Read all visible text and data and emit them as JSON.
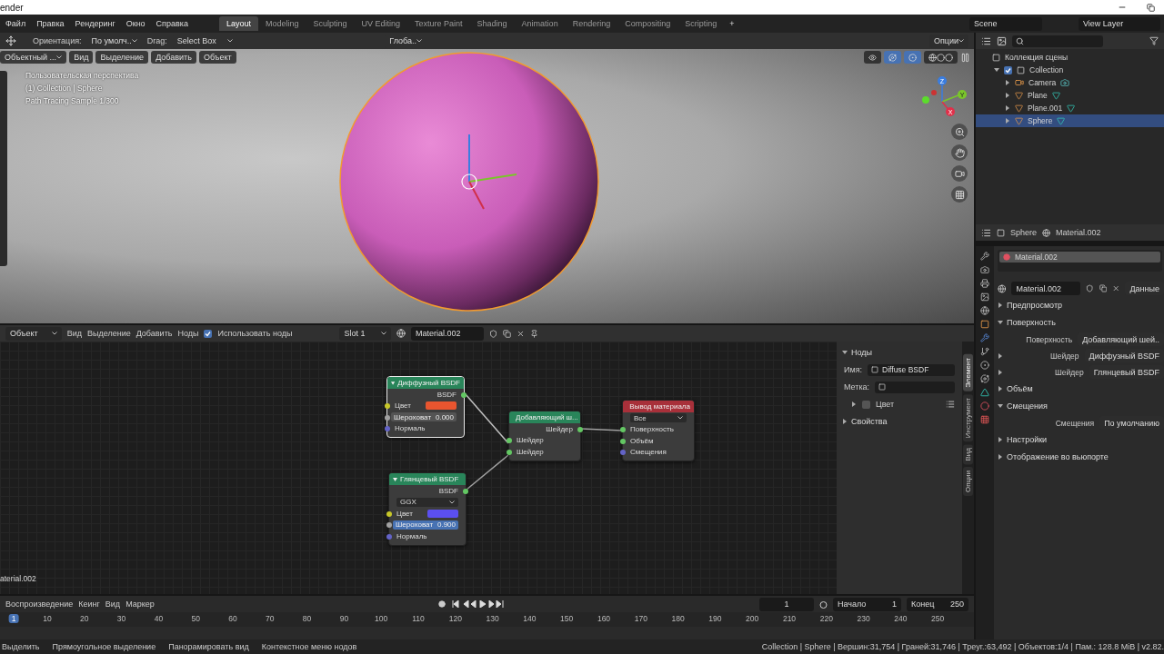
{
  "window": {
    "title": "ender"
  },
  "menu": [
    "Файл",
    "Правка",
    "Рендеринг",
    "Окно",
    "Справка"
  ],
  "workspaces": [
    {
      "label": "Layout",
      "selected": true
    },
    {
      "label": "Modeling",
      "selected": false
    },
    {
      "label": "Sculpting",
      "selected": false
    },
    {
      "label": "UV Editing",
      "selected": false
    },
    {
      "label": "Texture Paint",
      "selected": false
    },
    {
      "label": "Shading",
      "selected": false
    },
    {
      "label": "Animation",
      "selected": false
    },
    {
      "label": "Rendering",
      "selected": false
    },
    {
      "label": "Compositing",
      "selected": false
    },
    {
      "label": "Scripting",
      "selected": false
    }
  ],
  "add_workspace": "+",
  "scene": "Scene",
  "view_layer": "View Layer",
  "tool_header": {
    "orientation_label": "Ориентация:",
    "orientation": "По умолч..",
    "drag_label": "Drag:",
    "drag": "Select Box",
    "transform": "Глоба..",
    "options": "Опции"
  },
  "viewport": {
    "mode": "Объектный ...",
    "menus": [
      "Вид",
      "Выделение",
      "Добавить",
      "Объект"
    ],
    "info": [
      "Пользовательская перспектива",
      "(1) Collection | Sphere",
      "Path Tracing Sample 1/300"
    ],
    "axes": [
      "Z",
      "Y",
      "X"
    ]
  },
  "outliner": {
    "root": "Коллекция сцены",
    "collection": {
      "label": "Collection",
      "checked": true,
      "expanded": true
    },
    "items": [
      {
        "label": "Camera",
        "kind": "camera",
        "selected": false
      },
      {
        "label": "Plane",
        "kind": "mesh",
        "selected": false
      },
      {
        "label": "Plane.001",
        "kind": "mesh",
        "selected": false
      },
      {
        "label": "Sphere",
        "kind": "mesh",
        "selected": true
      }
    ]
  },
  "properties": {
    "object": "Sphere",
    "material": "Material.002",
    "slots": [
      {
        "label": "Material.002",
        "selected": true
      }
    ],
    "material_field": "Material.002",
    "link": "Данные",
    "panels": [
      {
        "label": "Предпросмотр",
        "expanded": false
      },
      {
        "label": "Поверхность",
        "expanded": true,
        "rows": [
          {
            "label": "Поверхность",
            "value": "Добавляющий шей.."
          },
          {
            "label": "Шейдер",
            "value": "Диффузный BSDF",
            "expandable": true
          },
          {
            "label": "Шейдер",
            "value": "Глянцевый BSDF",
            "expandable": true
          }
        ]
      },
      {
        "label": "Объём",
        "expanded": false
      },
      {
        "label": "Смещения",
        "expanded": true,
        "rows": [
          {
            "label": "Смещения",
            "value": "По умолчанию"
          }
        ]
      },
      {
        "label": "Настройки",
        "expanded": false
      },
      {
        "label": "Отображение во вьюпорте",
        "expanded": false
      }
    ]
  },
  "node_editor": {
    "mode": "Объект",
    "menus": [
      "Вид",
      "Выделение",
      "Добавить",
      "Ноды"
    ],
    "use_nodes": {
      "label": "Использовать ноды",
      "checked": true
    },
    "slot": "Slot 1",
    "material": "Material.002",
    "footer": "aterial.002",
    "nodes": [
      {
        "title": "Диффузный BSDF",
        "kind": "shader",
        "selected": true,
        "outputs": [
          "BSDF"
        ],
        "inputs": [
          {
            "label": "Цвет",
            "kind": "color",
            "color": "#e8552f"
          },
          {
            "label": "Шероховат",
            "kind": "value",
            "value": "0.000",
            "selected": false
          },
          {
            "label": "Нормаль",
            "kind": "socket"
          }
        ]
      },
      {
        "title": "Глянцевый BSDF",
        "kind": "shader",
        "selected": false,
        "outputs": [
          "BSDF"
        ],
        "dropdown": "GGX",
        "inputs": [
          {
            "label": "Цвет",
            "kind": "color",
            "color": "#5b4ff0"
          },
          {
            "label": "Шероховат",
            "kind": "value",
            "value": "0.900",
            "selected": true
          },
          {
            "label": "Нормаль",
            "kind": "socket"
          }
        ]
      },
      {
        "title": "Добавляющий ш...",
        "kind": "shader",
        "selected": false,
        "outputs": [
          "Шейдер"
        ],
        "inputs": [
          {
            "label": "Шейдер",
            "kind": "socket"
          },
          {
            "label": "Шейдер",
            "kind": "socket"
          }
        ]
      },
      {
        "title": "Вывод материала",
        "kind": "output",
        "selected": false,
        "dropdown": "Все",
        "inputs": [
          {
            "label": "Поверхность",
            "kind": "socket"
          },
          {
            "label": "Объём",
            "kind": "socket"
          },
          {
            "label": "Смещения",
            "kind": "socket"
          }
        ]
      }
    ],
    "sidebar": {
      "panel": "Ноды",
      "name_label": "Имя:",
      "name": "Diffuse BSDF",
      "label_label": "Метка:",
      "color": {
        "label": "Цвет",
        "checked": false
      },
      "properties": "Свойства",
      "tabs": [
        {
          "label": "Элемент",
          "selected": true
        },
        {
          "label": "Инструмент",
          "selected": false
        },
        {
          "label": "Вид",
          "selected": false
        },
        {
          "label": "Опции",
          "selected": false
        }
      ]
    }
  },
  "timeline": {
    "menus": [
      "Воспроизведение",
      "Кеинг",
      "Вид",
      "Маркер"
    ],
    "current": "1",
    "start_label": "Начало",
    "start": "1",
    "end_label": "Конец",
    "end": "250",
    "ruler": [
      {
        "label": "1",
        "selected": true
      },
      {
        "label": "10",
        "selected": false
      },
      {
        "label": "20",
        "selected": false
      },
      {
        "label": "30",
        "selected": false
      },
      {
        "label": "40",
        "selected": false
      },
      {
        "label": "50",
        "selected": false
      },
      {
        "label": "60",
        "selected": false
      },
      {
        "label": "70",
        "selected": false
      },
      {
        "label": "80",
        "selected": false
      },
      {
        "label": "90",
        "selected": false
      },
      {
        "label": "100",
        "selected": false
      },
      {
        "label": "110",
        "selected": false
      },
      {
        "label": "120",
        "selected": false
      },
      {
        "label": "130",
        "selected": false
      },
      {
        "label": "140",
        "selected": false
      },
      {
        "label": "150",
        "selected": false
      },
      {
        "label": "160",
        "selected": false
      },
      {
        "label": "170",
        "selected": false
      },
      {
        "label": "180",
        "selected": false
      },
      {
        "label": "190",
        "selected": false
      },
      {
        "label": "200",
        "selected": false
      },
      {
        "label": "210",
        "selected": false
      },
      {
        "label": "220",
        "selected": false
      },
      {
        "label": "230",
        "selected": false
      },
      {
        "label": "240",
        "selected": false
      },
      {
        "label": "250",
        "selected": false
      }
    ]
  },
  "status_bar": {
    "hints": [
      "Выделить",
      "Прямоугольное выделение",
      "Панорамировать вид",
      "Контекстное меню нодов"
    ],
    "stats": "Collection | Sphere | Вершин:31,754 | Граней:31,746 | Треуг.:63,492 | Объектов:1/4 | Пам.: 128.8 MiB | v2.82."
  }
}
